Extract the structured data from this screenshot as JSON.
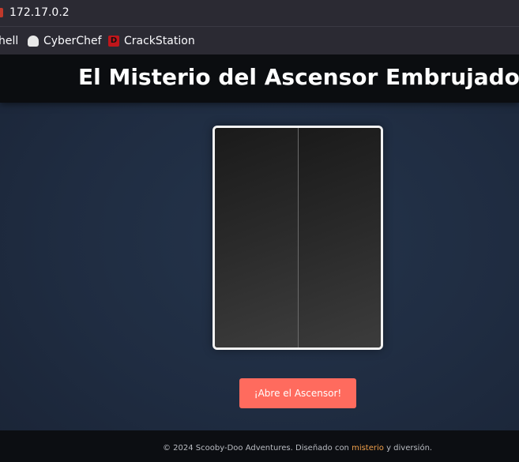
{
  "browser": {
    "url": "172.17.0.2",
    "bookmarks": [
      {
        "label": "hell",
        "icon": "shell-bookmark-icon"
      },
      {
        "label": "CyberChef",
        "icon": "chef-hat-icon"
      },
      {
        "label": "CrackStation",
        "icon": "crackstation-icon"
      }
    ]
  },
  "page": {
    "title": "El Misterio del Ascensor Embrujado",
    "button_label": "¡Abre el Ascensor!",
    "footer": {
      "prefix": "© 2024 Scooby-Doo Adventures. Diseñado con ",
      "link": "misterio",
      "suffix": " y diversión."
    }
  },
  "colors": {
    "button": "#ff6b5e",
    "link": "#f0a04b",
    "background": "#1f2c41"
  }
}
